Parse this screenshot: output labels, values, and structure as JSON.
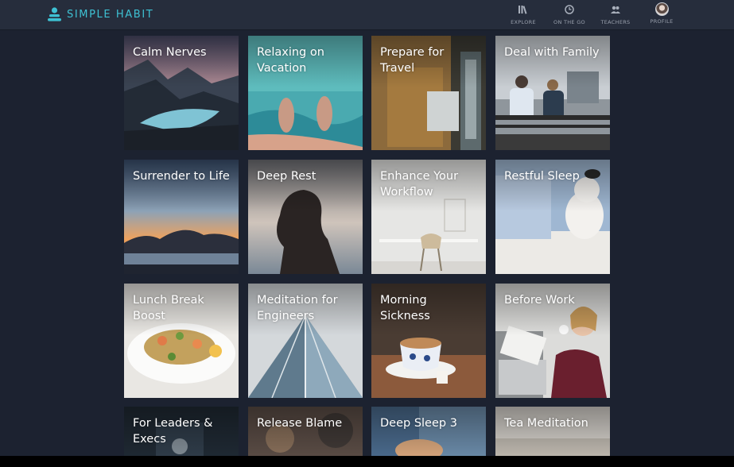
{
  "app": {
    "name": "SIMPLE HABIT"
  },
  "nav": {
    "items": [
      {
        "label": "EXPLORE",
        "icon": "library-icon"
      },
      {
        "label": "ON THE GO",
        "icon": "clock-icon"
      },
      {
        "label": "TEACHERS",
        "icon": "people-icon"
      },
      {
        "label": "PROFILE",
        "icon": "avatar-icon"
      }
    ]
  },
  "tiles": [
    {
      "title": "Calm Nerves"
    },
    {
      "title": "Relaxing on Vacation"
    },
    {
      "title": "Prepare for Travel"
    },
    {
      "title": "Deal with Family"
    },
    {
      "title": "Surrender to Life"
    },
    {
      "title": "Deep Rest"
    },
    {
      "title": "Enhance Your Workflow"
    },
    {
      "title": "Restful Sleep"
    },
    {
      "title": "Lunch Break Boost"
    },
    {
      "title": "Meditation for Engineers"
    },
    {
      "title": "Morning Sickness"
    },
    {
      "title": "Before Work"
    },
    {
      "title": "For Leaders & Execs"
    },
    {
      "title": "Release Blame"
    },
    {
      "title": "Deep Sleep 3"
    },
    {
      "title": "Tea Meditation"
    }
  ],
  "colors": {
    "brand": "#3ec1d3",
    "header": "#262d3c",
    "background": "#1c2230"
  }
}
